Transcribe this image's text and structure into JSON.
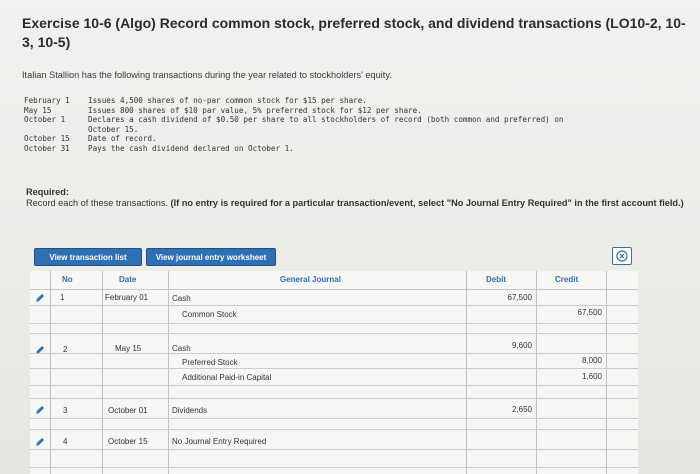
{
  "title": "Exercise 10-6 (Algo) Record common stock, preferred stock, and dividend transactions (LO10-2, 10-3, 10-5)",
  "intro": "Italian Stallion has the following transactions during the year related to stockholders' equity.",
  "transactions": [
    {
      "date": "February 1",
      "text": "Issues 4,500 shares of no-par common stock for $15 per share."
    },
    {
      "date": "May 15",
      "text": "Issues 800 shares of $10 par value, 5% preferred stock for $12 per share."
    },
    {
      "date": "October 1",
      "text": "Declares a cash dividend of $0.50 per share to all stockholders of record (both common and preferred) on",
      "cont": "October 15."
    },
    {
      "date": "October 15",
      "text": "Date of record."
    },
    {
      "date": "October 31",
      "text": "Pays the cash dividend declared on October 1."
    }
  ],
  "required_label": "Required:",
  "required_text": "Record each of these transactions.",
  "required_bold": "(If no entry is required for a particular transaction/event, select \"No Journal Entry Required\" in the first account field.)",
  "buttons": {
    "view_transaction_list": "View transaction list",
    "view_journal_worksheet": "View journal entry worksheet"
  },
  "close_icon": "close-circle-icon",
  "table": {
    "headers": {
      "no": "No",
      "date": "Date",
      "general_journal": "General Journal",
      "debit": "Debit",
      "credit": "Credit"
    },
    "rows": [
      {
        "no": "1",
        "date": "February 01",
        "lines": [
          {
            "account": "Cash",
            "indent": false,
            "debit": "67,500",
            "credit": ""
          },
          {
            "account": "Common Stock",
            "indent": true,
            "debit": "",
            "credit": "67,500"
          }
        ]
      },
      {
        "no": "2",
        "date": "May 15",
        "lines": [
          {
            "account": "Cash",
            "indent": false,
            "debit": "9,600",
            "credit": ""
          },
          {
            "account": "Preferred Stock",
            "indent": true,
            "debit": "",
            "credit": "8,000"
          },
          {
            "account": "Additional Paid-in Capital",
            "indent": true,
            "debit": "",
            "credit": "1,600"
          }
        ]
      },
      {
        "no": "3",
        "date": "October 01",
        "lines": [
          {
            "account": "Dividends",
            "indent": false,
            "debit": "2,650",
            "credit": ""
          }
        ]
      },
      {
        "no": "4",
        "date": "October 15",
        "lines": [
          {
            "account": "No Journal Entry Required",
            "indent": false,
            "debit": "",
            "credit": ""
          }
        ]
      }
    ]
  },
  "colors": {
    "accent": "#2f6fb3",
    "text": "#333333"
  }
}
